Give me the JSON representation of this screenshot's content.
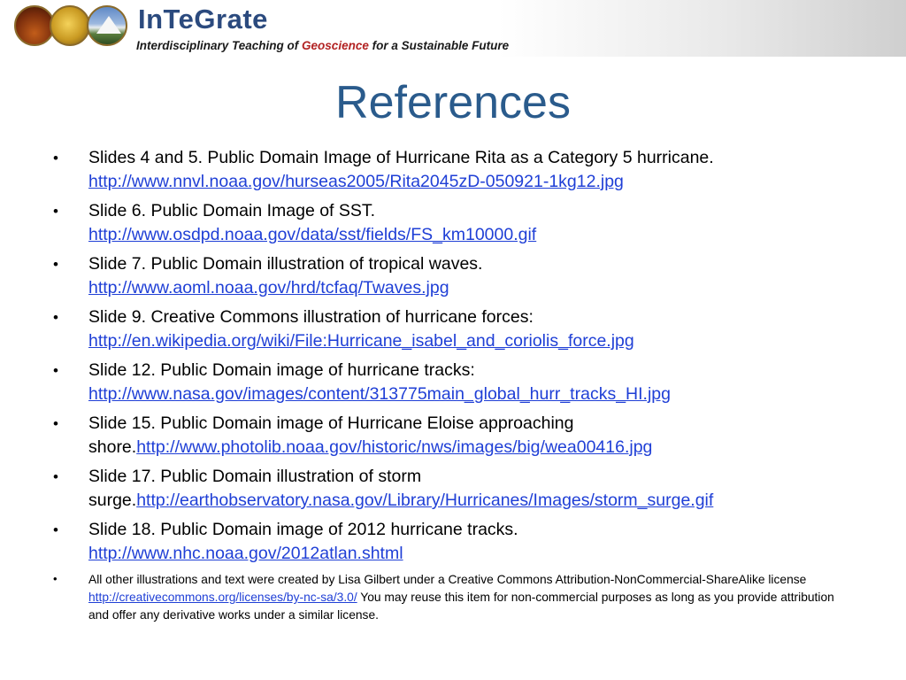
{
  "header": {
    "brand": "InTeGrate",
    "tagline_part1": "Interdisciplinary Teaching of ",
    "tagline_accent": "Geoscience",
    "tagline_part2": " for a Sustainable Future",
    "logo_icons": [
      "refinery-photo",
      "gold-nugget-photo",
      "mountain-photo"
    ]
  },
  "title": "References",
  "bullet_glyph": "•",
  "references": [
    {
      "text": "Slides 4 and 5. Public Domain Image of Hurricane Rita as a Category 5 hurricane.",
      "url": "http://www.nnvl.noaa.gov/hurseas2005/Rita2045zD-050921-1kg12.jpg"
    },
    {
      "text": "Slide 6. Public Domain Image of SST.",
      "url": "http://www.osdpd.noaa.gov/data/sst/fields/FS_km10000.gif"
    },
    {
      "text": "Slide 7. Public Domain illustration of tropical waves.",
      "url": "http://www.aoml.noaa.gov/hrd/tcfaq/Twaves.jpg"
    },
    {
      "text": "Slide 9. Creative Commons illustration of hurricane forces:",
      "url": "http://en.wikipedia.org/wiki/File:Hurricane_isabel_and_coriolis_force.jpg"
    },
    {
      "text": "Slide 12. Public Domain image of hurricane tracks:",
      "url": "http://www.nasa.gov/images/content/313775main_global_hurr_tracks_HI.jpg"
    },
    {
      "text": "Slide 15. Public Domain image of Hurricane Eloise approaching shore.",
      "url": "http://www.photolib.noaa.gov/historic/nws/images/big/wea00416.jpg"
    },
    {
      "text": "Slide 17. Public Domain illustration of storm surge.",
      "url": "http://earthobservatory.nasa.gov/Library/Hurricanes/Images/storm_surge.gif"
    },
    {
      "text": "Slide 18. Public Domain image of 2012 hurricane tracks.",
      "url": "http://www.nhc.noaa.gov/2012atlan.shtml"
    }
  ],
  "license_note": {
    "text_before": "All other illustrations and text were created by Lisa Gilbert under a Creative Commons Attribution-NonCommercial-ShareAlike license ",
    "url": "http://creativecommons.org/licenses/by-nc-sa/3.0/",
    "text_after": " You may reuse this item for non-commercial purposes as long as you provide attribution and offer any derivative works under a similar license."
  }
}
